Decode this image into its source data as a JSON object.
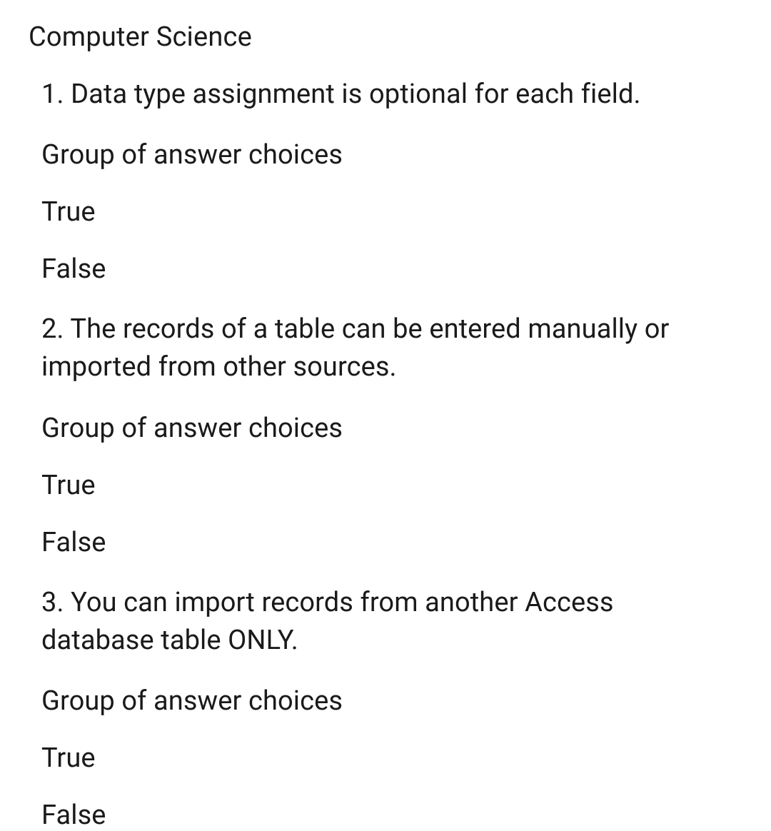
{
  "subject": "Computer Science",
  "questions": [
    {
      "text": "1. Data type assignment is optional for each field.",
      "group_label": "Group of answer choices",
      "choices": [
        "True",
        "False"
      ]
    },
    {
      "text": "2. The records of a table can be entered manually or imported from other sources.",
      "group_label": "Group of answer choices",
      "choices": [
        "True",
        "False"
      ]
    },
    {
      "text": "3. You can import records from another Access database table ONLY.",
      "group_label": "Group of answer choices",
      "choices": [
        "True",
        "False"
      ]
    }
  ]
}
